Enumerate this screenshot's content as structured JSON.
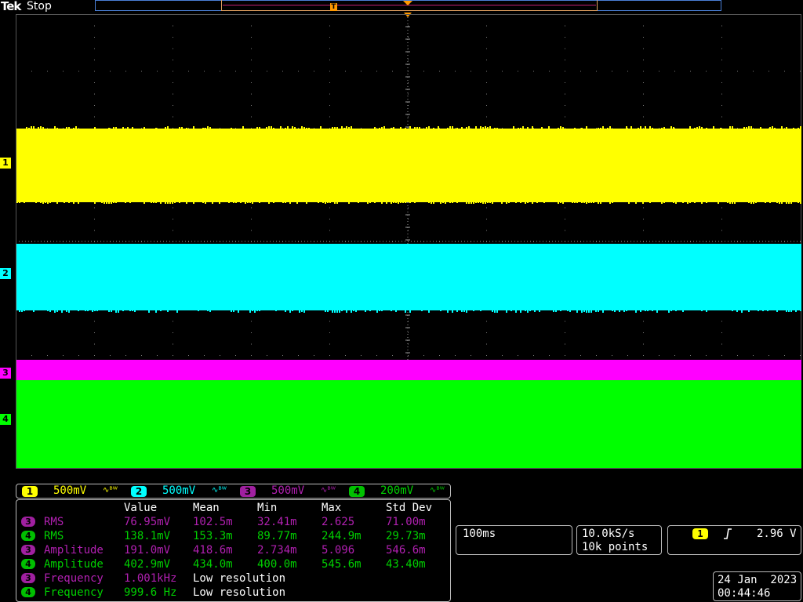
{
  "header": {
    "brand": "Tek",
    "run_state": "Stop",
    "trigger_pos_marker": "T"
  },
  "colors": {
    "ch1": "#ffff00",
    "ch2": "#00ffff",
    "ch3": "#ff00ff",
    "ch4": "#00ff00",
    "background": "#000000",
    "graticule": "#888888",
    "accent_trigger": "#ff9900"
  },
  "channels": [
    {
      "num": "1",
      "scale": "500mV",
      "bw_icon": "bandwidth-limit-icon"
    },
    {
      "num": "2",
      "scale": "500mV",
      "bw_icon": "bandwidth-limit-icon"
    },
    {
      "num": "3",
      "scale": "500mV",
      "bw_icon": "bandwidth-limit-icon"
    },
    {
      "num": "4",
      "scale": "200mV",
      "bw_icon": "bandwidth-limit-icon"
    }
  ],
  "measurements": {
    "headers": [
      "Value",
      "Mean",
      "Min",
      "Max",
      "Std Dev"
    ],
    "rows": [
      {
        "ch": "3",
        "name": "RMS",
        "value": "76.95mV",
        "mean": "102.5m",
        "min": "32.41m",
        "max": "2.625",
        "std": "71.00m"
      },
      {
        "ch": "4",
        "name": "RMS",
        "value": "138.1mV",
        "mean": "153.3m",
        "min": "89.77m",
        "max": "244.9m",
        "std": "29.73m"
      },
      {
        "ch": "3",
        "name": "Amplitude",
        "value": "191.0mV",
        "mean": "418.6m",
        "min": "2.734m",
        "max": "5.096",
        "std": "546.6m"
      },
      {
        "ch": "4",
        "name": "Amplitude",
        "value": "402.9mV",
        "mean": "434.0m",
        "min": "400.0m",
        "max": "545.6m",
        "std": "43.40m"
      },
      {
        "ch": "3",
        "name": "Frequency",
        "value": "1.001kHz",
        "note": "Low resolution"
      },
      {
        "ch": "4",
        "name": "Frequency",
        "value": "999.6 Hz",
        "note": "Low resolution"
      }
    ]
  },
  "timebase": {
    "scale": "100ms"
  },
  "acquisition": {
    "sample_rate": "10.0kS/s",
    "record_length": "10k points"
  },
  "trigger": {
    "source": "1",
    "slope_icon": "rising-edge-icon",
    "level": "2.96 V"
  },
  "datetime": {
    "date": "24 Jan  2023",
    "time": "00:44:46"
  }
}
